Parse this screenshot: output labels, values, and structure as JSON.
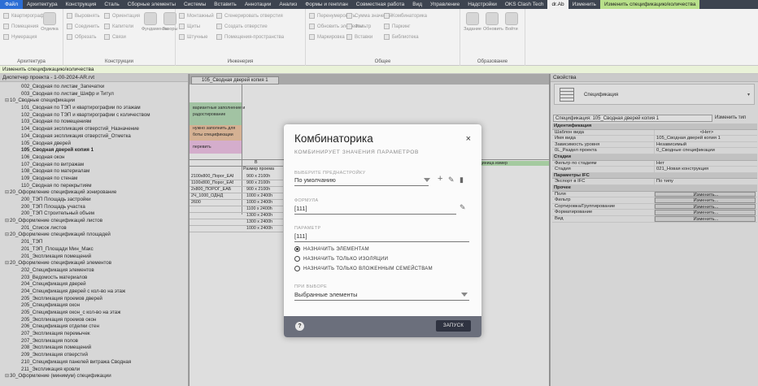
{
  "ribbon": {
    "tabs": [
      "Файл",
      "Архитектура",
      "Конструкция",
      "Сталь",
      "Сборные элементы",
      "Системы",
      "Вставить",
      "Аннотации",
      "Анализ",
      "Формы и генплан",
      "Совместная работа",
      "Вид",
      "Управление",
      "Надстройки",
      "OKS Сlash Tech",
      "dr.Ab",
      "Изменить",
      "Изменить спецификацию/количества"
    ],
    "groups": [
      {
        "title": "Архитектура",
        "items": [
          "Квартирография",
          "Помещения",
          "Нумерация",
          "Отделка"
        ]
      },
      {
        "title": "Конструкции",
        "items": [
          "Выровнять",
          "Соединить",
          "Обрезать",
          "Ориентация",
          "Капители",
          "Связи",
          "Фундаменты",
          "Зазоры"
        ]
      },
      {
        "title": "Инженерия",
        "items": [
          "Монтажный",
          "Щиты",
          "Штучные",
          "Сгенерировать отверстия",
          "Создать отверстие",
          "Помещения-пространства"
        ]
      },
      {
        "title": "Общее",
        "items": [
          "Перенумеровать",
          "Обновить элементы",
          "Маркировка",
          "Сумма значений",
          "Фильтр",
          "Вставки",
          "Комбинаторика",
          "Паркинг",
          "Библиотека"
        ]
      },
      {
        "title": "Образование",
        "items": [
          "Задание",
          "Обновить",
          "Войти"
        ]
      }
    ]
  },
  "context_bar": "Изменить спецификацию/количества",
  "browser": {
    "title": "Диспетчер проекта - 1-00-2024-АR.rvt",
    "items": [
      {
        "label": "002_Сводная по листам_Запечатки",
        "level": 2
      },
      {
        "label": "003_Сводная по листам_Шифр и Титул",
        "level": 2
      },
      {
        "label": "10_Сводные спецификации",
        "level": 1,
        "exp": "⊟"
      },
      {
        "label": "101_Сводная по ТЭП и квартирографии по этажам",
        "level": 2
      },
      {
        "label": "102_Сводная по ТЭП и квартирографии с количеством",
        "level": 2
      },
      {
        "label": "103_Сводная по помещениям",
        "level": 2
      },
      {
        "label": "104_Сводная экспликация отверстий_Назначение",
        "level": 2
      },
      {
        "label": "104_Сводная экспликация отверстий_Отметка",
        "level": 2
      },
      {
        "label": "105_Сводная дверей",
        "level": 2
      },
      {
        "label": "105_Сводная дверей копия 1",
        "level": 2,
        "selected": true
      },
      {
        "label": "106_Сводная окон",
        "level": 2
      },
      {
        "label": "107_Сводная по витражам",
        "level": 2
      },
      {
        "label": "108_Сводная по материалам",
        "level": 2
      },
      {
        "label": "109_Сводная по стенам",
        "level": 2
      },
      {
        "label": "110_Сводная по перекрытиям",
        "level": 2
      },
      {
        "label": "20_Оформление спецификаций зонирование",
        "level": 1,
        "exp": "⊟"
      },
      {
        "label": "200_ТЭП Площадь застройки",
        "level": 2
      },
      {
        "label": "200_ТЭП Площадь участка",
        "level": 2
      },
      {
        "label": "200_ТЭП Строительный объем",
        "level": 2
      },
      {
        "label": "20_Оформление спецификаций листов",
        "level": 1,
        "exp": "⊟"
      },
      {
        "label": "201_Список листов",
        "level": 2
      },
      {
        "label": "20_Оформление спецификаций площадей",
        "level": 1,
        "exp": "⊟"
      },
      {
        "label": "201_ТЭП",
        "level": 2
      },
      {
        "label": "201_ТЭП_Площади Мин_Макс",
        "level": 2
      },
      {
        "label": "201_Экспликация помещений",
        "level": 2
      },
      {
        "label": "20_Оформление спецификаций элементов",
        "level": 1,
        "exp": "⊟"
      },
      {
        "label": "202_Спецификация элементов",
        "level": 2
      },
      {
        "label": "203_Ведомость материалов",
        "level": 2
      },
      {
        "label": "204_Спецификация дверей",
        "level": 2
      },
      {
        "label": "204_Спецификация дверей с кол-во на этаж",
        "level": 2
      },
      {
        "label": "205_Экспликация проемов дверей",
        "level": 2
      },
      {
        "label": "205_Спецификация окон",
        "level": 2
      },
      {
        "label": "205_Спецификация окон_с кол-во на этаж",
        "level": 2
      },
      {
        "label": "205_Экспликация проемов окон",
        "level": 2
      },
      {
        "label": "206_Спецификация отделки стен",
        "level": 2
      },
      {
        "label": "207_Экспликация перемычек",
        "level": 2
      },
      {
        "label": "207_Экспликация полов",
        "level": 2
      },
      {
        "label": "208_Экспликация помещений",
        "level": 2
      },
      {
        "label": "209_Экспликация отверстий",
        "level": 2
      },
      {
        "label": "210_Спецификация панелей витража Сводная",
        "level": 2
      },
      {
        "label": "211_Экспликация кровли",
        "level": 2
      },
      {
        "label": "30_Оформление (минимум) спецификации",
        "level": 1,
        "exp": "⊟"
      }
    ]
  },
  "view": {
    "tab_label": "105_Сводная дверей копия 1",
    "notes": [
      "вариантные заполнение и",
      "радостирование",
      "нужно заполнить для",
      "боты спецификации",
      "перевить"
    ],
    "col_b": "B",
    "col_b_head": "Размер проема",
    "rows_a": [
      "2100х800_Порог_ЕАБ",
      "1100х800_Порог_ЕАБ",
      "2х800_ПОРОГ_ЕАБ",
      "2Ч_1000_ОДНД",
      "2600"
    ],
    "rows_b": [
      "900 х 2100h",
      "900 х 2100h",
      "900 х 2100h",
      "1000 х 2400h",
      "1000 х 2400h",
      "1100 х 2400h",
      "1300 х 2400h",
      "1300 х 2400h",
      "1000 х 2400h"
    ],
    "right_head": "Q_Единица измер"
  },
  "properties": {
    "title": "Свойства",
    "type_name": "Спецификация",
    "selector": "Спецификация: 105_Сводная дверей копия 1",
    "edit_type": "Изменить тип",
    "sections": [
      {
        "name": "Идентификация",
        "rows": [
          {
            "k": "Шаблон вида",
            "v": "<Нет>",
            "style": "ctr"
          },
          {
            "k": "Имя вида",
            "v": "105_Сводная дверей копия 1"
          },
          {
            "k": "Зависимость уровня",
            "v": "Независимый"
          },
          {
            "k": "0L_Раздел проекта",
            "v": "0_Сводные спецификации"
          }
        ]
      },
      {
        "name": "Стадии",
        "rows": [
          {
            "k": "Фильтр по стадиям",
            "v": "Нет"
          },
          {
            "k": "Стадия",
            "v": "021_Новая конструкция"
          }
        ]
      },
      {
        "name": "Параметры IFC",
        "rows": [
          {
            "k": "Экспорт в IFC",
            "v": "По типу"
          }
        ]
      },
      {
        "name": "Прочее",
        "rows": [
          {
            "k": "Поля",
            "v": "Изменить...",
            "style": "btn"
          },
          {
            "k": "Фильтр",
            "v": "Изменить...",
            "style": "btn"
          },
          {
            "k": "Сортировка/Группирование",
            "v": "Изменить...",
            "style": "btn"
          },
          {
            "k": "Форматирование",
            "v": "Изменить...",
            "style": "btn"
          },
          {
            "k": "Вид",
            "v": "Изменить...",
            "style": "btn"
          }
        ]
      }
    ]
  },
  "dialog": {
    "title": "Комбинаторика",
    "close": "×",
    "subtitle": "КОМБИНИРУЕТ ЗНАЧЕНИЯ ПАРАМЕТРОВ",
    "preset_label": "ВЫБЕРИТЕ ПРЕДНАСТРОЙКУ",
    "preset_value": "По умолчанию",
    "formula_label": "ФОРМУЛА",
    "formula_value": "[111]",
    "param_label": "ПАРАМЕТР",
    "param_value": "[111]",
    "radios": [
      {
        "label": "НАЗНАЧИТЬ ЭЛЕМЕНТАМ",
        "checked": true
      },
      {
        "label": "НАЗНАЧИТЬ ТОЛЬКО ИЗОЛЯЦИИ",
        "checked": false
      },
      {
        "label": "НАЗНАЧИТЬ ТОЛЬКО ВЛОЖЕННЫМ СЕМЕЙСТВАМ",
        "checked": false
      }
    ],
    "selection_label": "ПРИ ВЫБОРЕ",
    "selection_value": "Выбранные элементы",
    "help": "?",
    "run": "ЗАПУСК"
  }
}
